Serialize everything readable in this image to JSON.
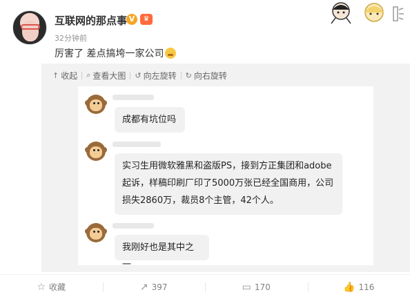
{
  "author": {
    "name": "互联网的那点事",
    "verified_badge": "V",
    "member_badge": "♛",
    "time": "32分钟前"
  },
  "post": {
    "text": "厉害了 差点搞垮一家公司"
  },
  "toolbar": {
    "collapse": "收起",
    "view_large": "查看大图",
    "rotate_left": "向左旋转",
    "rotate_right": "向右旋转"
  },
  "chat": {
    "messages": [
      {
        "text": "成都有坑位吗"
      },
      {
        "text": "实习生用微软雅黑和盗版PS，接到方正集团和adobe起诉，样稿印刷厂印了5000万张已经全国商用，公司损失2860万，裁员8个主管，42个人。"
      },
      {
        "text": "我刚好也是其中之一"
      }
    ]
  },
  "footer": {
    "favorite": "收藏",
    "repost_count": "397",
    "comment_count": "170",
    "like_count": "116"
  },
  "colors": {
    "media_bg": "#f2f2f2",
    "bubble_bg": "#f1f1f1",
    "verified": "#f5a623"
  }
}
